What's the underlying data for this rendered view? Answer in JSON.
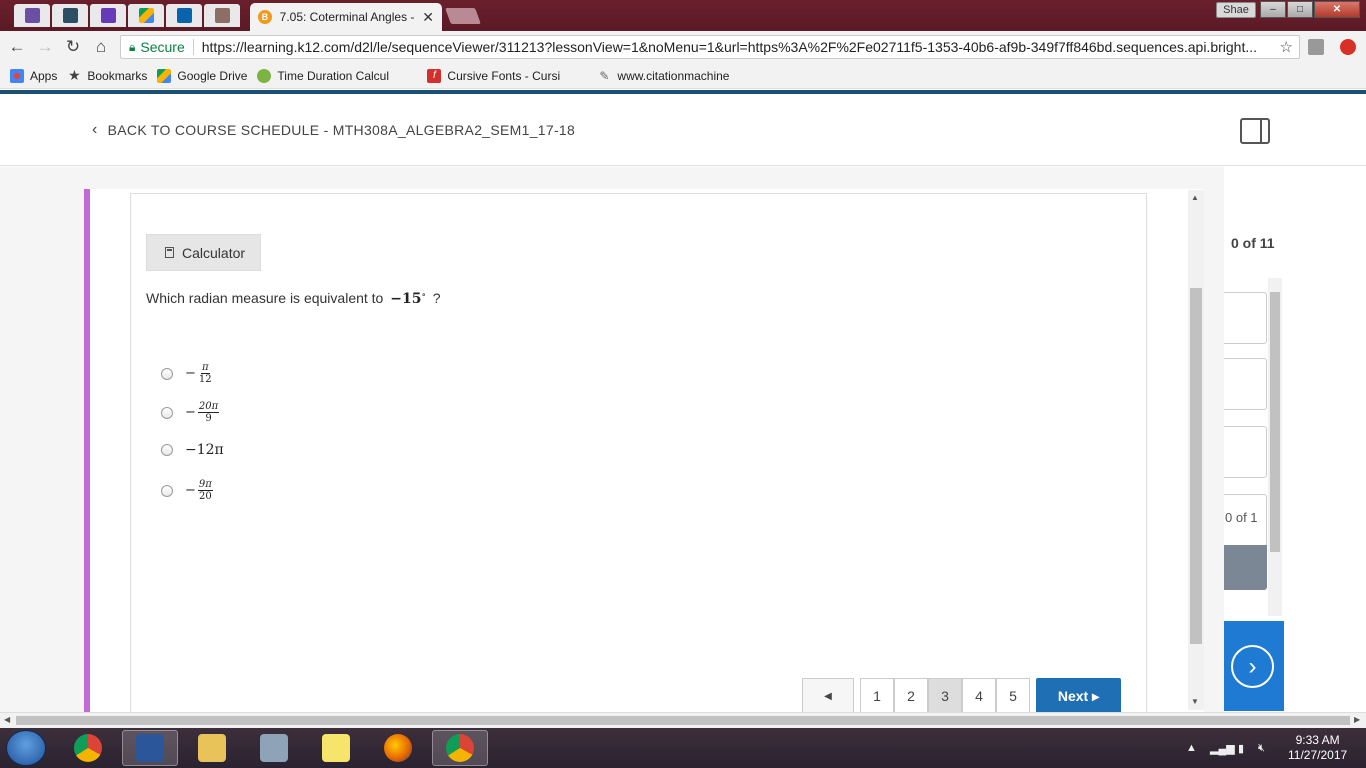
{
  "browser": {
    "active_tab_title": "7.05: Coterminal Angles -",
    "profile_name": "Shae",
    "window_buttons": {
      "minimize": "–",
      "maximize": "□",
      "close": "✕"
    },
    "address": {
      "secure_label": "Secure",
      "url": "https://learning.k12.com/d2l/le/sequenceViewer/311213?lessonView=1&noMenu=1&url=https%3A%2F%2Fe02711f5-1353-40b6-af9b-349f7ff846bd.sequences.api.bright..."
    },
    "bookmarks": [
      {
        "label": "Apps",
        "icon": "apps-grid-icon"
      },
      {
        "label": "Bookmarks",
        "icon": "star-icon"
      },
      {
        "label": "Google Drive",
        "icon": "google-drive-icon"
      },
      {
        "label": "Time Duration Calcul",
        "icon": "dot-icon"
      },
      {
        "label": "Cursive Fonts - Cursi",
        "icon": "font-icon"
      },
      {
        "label": "www.citationmachine",
        "icon": "citation-icon"
      }
    ]
  },
  "course": {
    "back_label": "BACK TO COURSE SCHEDULE - MTH308A_ALGEBRA2_SEM1_17-18"
  },
  "question": {
    "calculator_label": "Calculator",
    "prompt_text": "Which radian measure is equivalent to",
    "prompt_math": "−15",
    "prompt_degree": "∘",
    "prompt_end": "?",
    "choices": [
      {
        "sign": "−",
        "numerator": "π",
        "denominator": "12"
      },
      {
        "sign": "−",
        "numerator": "20π",
        "denominator": "9"
      },
      {
        "expression": "−12π"
      },
      {
        "sign": "−",
        "numerator": "9π",
        "denominator": "20"
      }
    ]
  },
  "pagination": {
    "prev_symbol": "◀",
    "pages": [
      "1",
      "2",
      "3",
      "4",
      "5"
    ],
    "current_page": "3",
    "next_label": "Next ▸"
  },
  "side_panel": {
    "count_top": "0 of 11",
    "count_mid": "0 of 1",
    "arrow_symbol": "›"
  },
  "taskbar": {
    "time": "9:33 AM",
    "date": "11/27/2017"
  },
  "colors": {
    "accent_purple": "#c36ad8",
    "next_blue": "#1f6fb5",
    "side_blue": "#1f7ad4",
    "secure_green": "#0b8043",
    "tab_bar": "#6b1f2c"
  }
}
